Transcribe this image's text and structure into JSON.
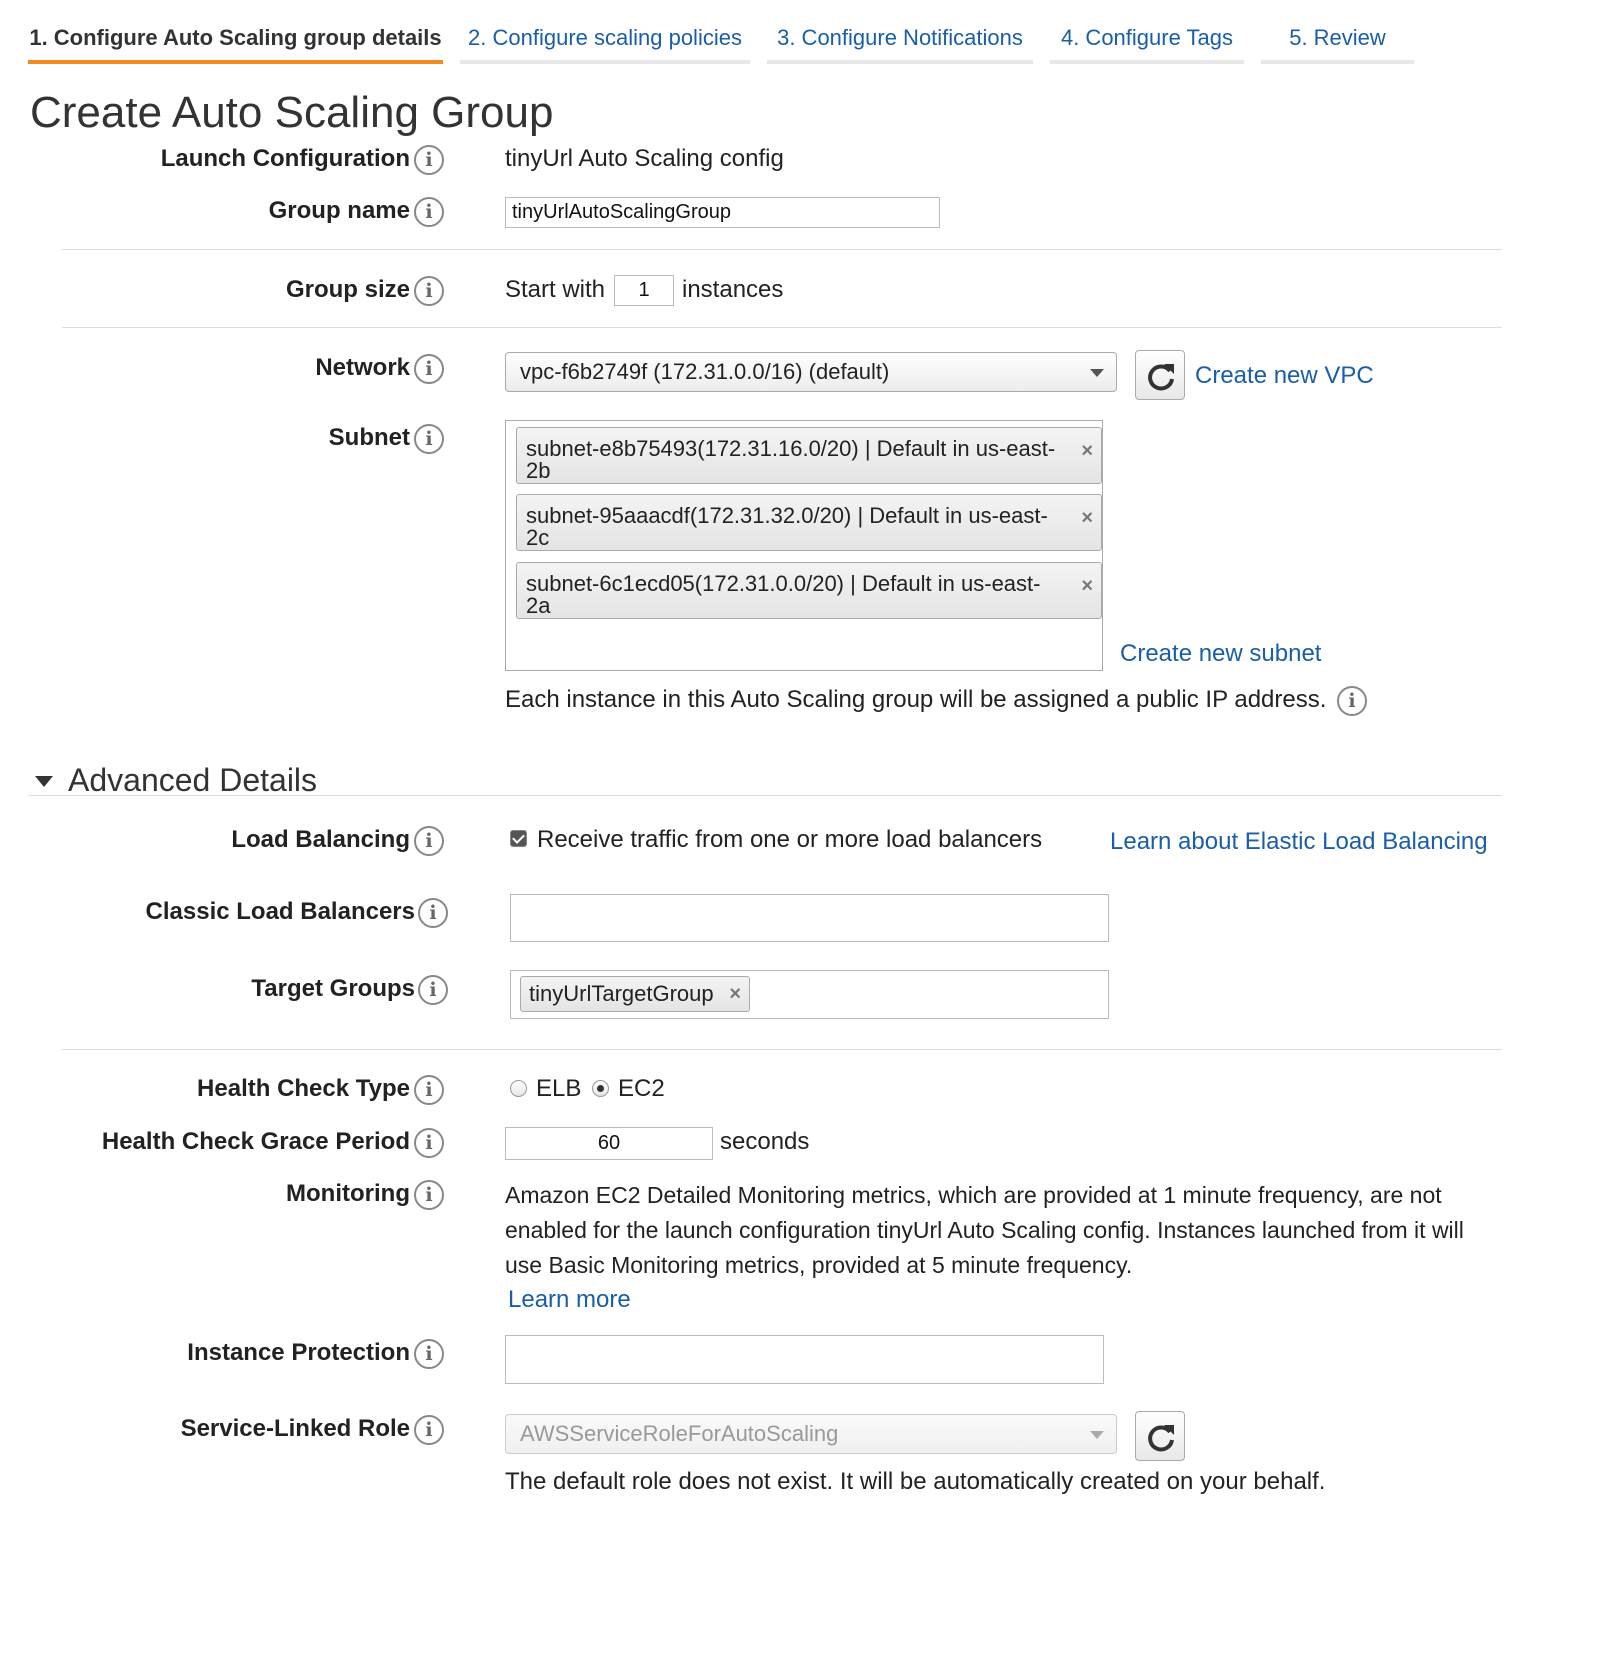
{
  "tabs": [
    {
      "label": "1. Configure Auto Scaling group details"
    },
    {
      "label": "2. Configure scaling policies"
    },
    {
      "label": "3. Configure Notifications"
    },
    {
      "label": "4. Configure Tags"
    },
    {
      "label": "5. Review"
    }
  ],
  "active_tab": 0,
  "page_title": "Create Auto Scaling Group",
  "info_glyph": "i",
  "launch_configuration": {
    "label": "Launch Configuration",
    "value": "tinyUrl Auto Scaling config"
  },
  "group_name": {
    "label": "Group name",
    "value": "tinyUrlAutoScalingGroup"
  },
  "group_size": {
    "label": "Group size",
    "prefix": "Start with",
    "value": "1",
    "suffix": "instances"
  },
  "network": {
    "label": "Network",
    "selected": "vpc-f6b2749f (172.31.0.0/16) (default)",
    "create_link": "Create new VPC"
  },
  "subnet": {
    "label": "Subnet",
    "items": [
      {
        "line1": "subnet-e8b75493(172.31.16.0/20) | Default in us-east-",
        "line2": "2b"
      },
      {
        "line1": "subnet-95aaacdf(172.31.32.0/20) | Default in us-east-",
        "line2": "2c"
      },
      {
        "line1": "subnet-6c1ecd05(172.31.0.0/20) | Default in us-east-",
        "line2": "2a"
      }
    ],
    "remove_glyph": "×",
    "create_link": "Create new subnet",
    "public_ip_note": "Each instance in this Auto Scaling group will be assigned a public IP address."
  },
  "advanced": {
    "title": "Advanced Details"
  },
  "load_balancing": {
    "label": "Load Balancing",
    "checkbox_label": "Receive traffic from one or more load balancers",
    "checked": true,
    "learn_link": "Learn about Elastic Load Balancing"
  },
  "classic_lb": {
    "label": "Classic Load Balancers",
    "value": ""
  },
  "target_groups": {
    "label": "Target Groups",
    "items": [
      "tinyUrlTargetGroup"
    ]
  },
  "health_check_type": {
    "label": "Health Check Type",
    "options": [
      "ELB",
      "EC2"
    ],
    "selected": "EC2"
  },
  "grace_period": {
    "label": "Health Check Grace Period",
    "value": "60",
    "suffix": "seconds"
  },
  "monitoring": {
    "label": "Monitoring",
    "text": "Amazon EC2 Detailed Monitoring metrics, which are provided at 1 minute frequency, are not enabled for the launch configuration tinyUrl Auto Scaling config. Instances launched from it will use Basic Monitoring metrics, provided at 5 minute frequency.",
    "learn_link": "Learn more"
  },
  "instance_protection": {
    "label": "Instance Protection",
    "value": ""
  },
  "service_role": {
    "label": "Service-Linked Role",
    "selected": "AWSServiceRoleForAutoScaling",
    "note": "The default role does not exist. It will be automatically created on your behalf."
  },
  "colors": {
    "accent_tab": "#f08b21",
    "link": "#1a5ea8"
  }
}
